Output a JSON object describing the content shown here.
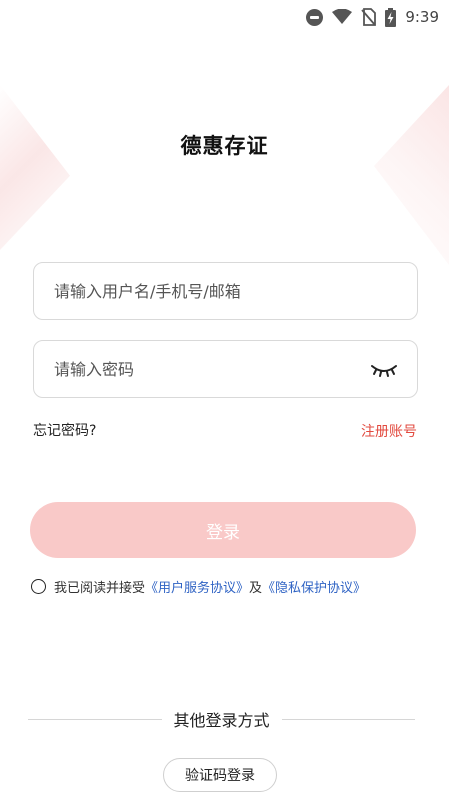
{
  "status_bar": {
    "time": "9:39",
    "icons": [
      "do-not-disturb-icon",
      "wifi-icon",
      "no-sim-icon",
      "battery-charging-icon"
    ]
  },
  "app": {
    "title": "德惠存证"
  },
  "login_form": {
    "username_placeholder": "请输入用户名/手机号/邮箱",
    "password_placeholder": "请输入密码",
    "forgot_password": "忘记密码?",
    "register": "注册账号",
    "login_button": "登录",
    "agreement_prefix": "我已阅读并接受",
    "user_agreement": "《用户服务协议》",
    "and": "及",
    "privacy_policy": "《隐私保护协议》"
  },
  "other_login": {
    "title": "其他登录方式",
    "sms_login": "验证码登录"
  },
  "colors": {
    "accent_red": "#e24a3f",
    "login_button_bg": "#f9c9c8",
    "link_blue": "#2f63c4"
  }
}
